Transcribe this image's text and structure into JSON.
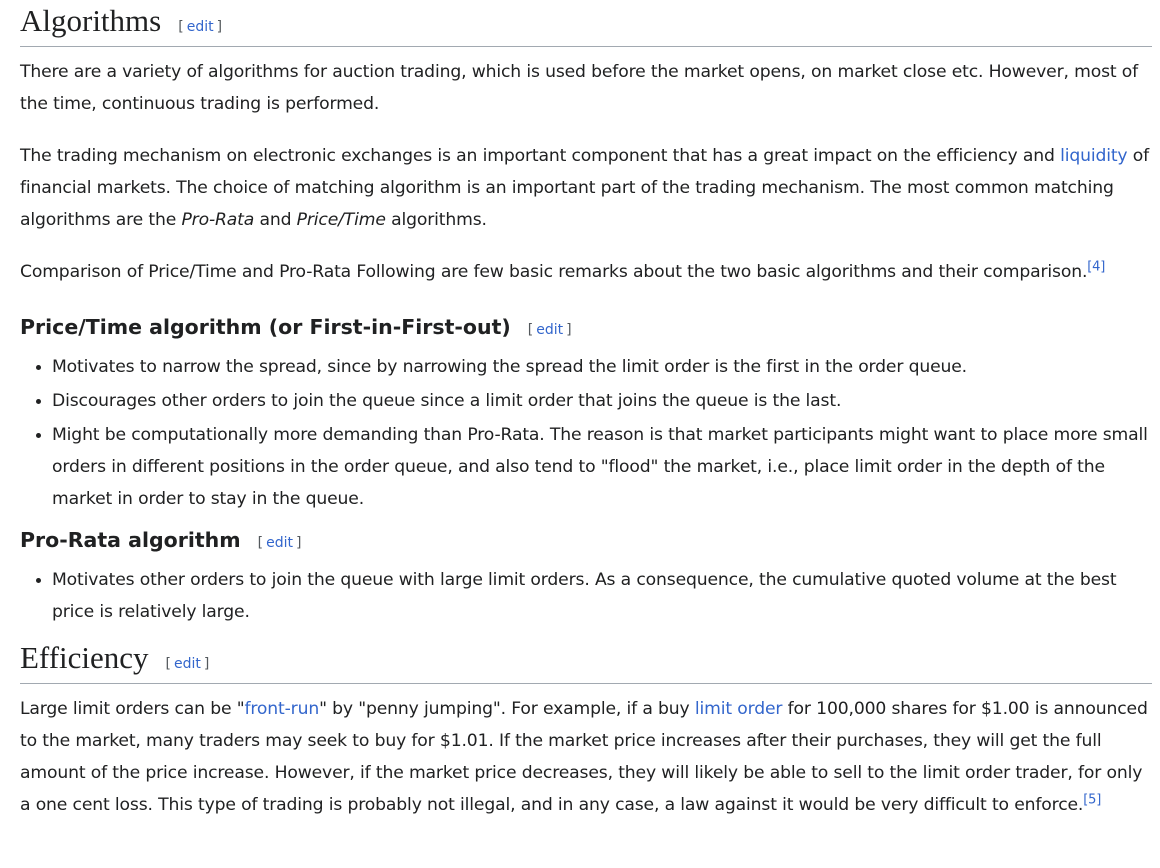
{
  "edit_label": "edit",
  "algorithms": {
    "heading": "Algorithms",
    "p1": "There are a variety of algorithms for auction trading, which is used before the market opens, on market close etc. However, most of the time, continuous trading is performed.",
    "p2_before": "The trading mechanism on electronic exchanges is an important component that has a great impact on the efficiency and ",
    "p2_link": "liquidity",
    "p2_mid1": " of financial markets. The choice of matching algorithm is an important part of the trading mechanism. The most common matching algorithms are the ",
    "p2_em1": "Pro-Rata",
    "p2_and": " and ",
    "p2_em2": "Price/Time",
    "p2_end": " algorithms.",
    "p3": "Comparison of Price/Time and Pro-Rata Following are few basic remarks about the two basic algorithms and their comparison.",
    "p3_ref": "[4]"
  },
  "price_time": {
    "heading": "Price/Time algorithm (or First-in-First-out)",
    "items": [
      "Motivates to narrow the spread, since by narrowing the spread the limit order is the first in the order queue.",
      "Discourages other orders to join the queue since a limit order that joins the queue is the last.",
      "Might be computationally more demanding than Pro-Rata. The reason is that market participants might want to place more small orders in different positions in the order queue, and also tend to \"flood\" the market, i.e., place limit order in the depth of the market in order to stay in the queue."
    ]
  },
  "pro_rata": {
    "heading": "Pro-Rata algorithm",
    "items": [
      "Motivates other orders to join the queue with large limit orders. As a consequence, the cumulative quoted volume at the best price is relatively large."
    ]
  },
  "efficiency": {
    "heading": "Efficiency",
    "p_start": "Large limit orders can be \"",
    "link1": "front-run",
    "p_mid1": "\" by \"penny jumping\". For example, if a buy ",
    "link2": "limit order",
    "p_end": " for 100,000 shares for $1.00 is announced to the market, many traders may seek to buy for $1.01. If the market price increases after their purchases, they will get the full amount of the price increase. However, if the market price decreases, they will likely be able to sell to the limit order trader, for only a one cent loss. This type of trading is probably not illegal, and in any case, a law against it would be very difficult to enforce.",
    "ref": "[5]"
  }
}
